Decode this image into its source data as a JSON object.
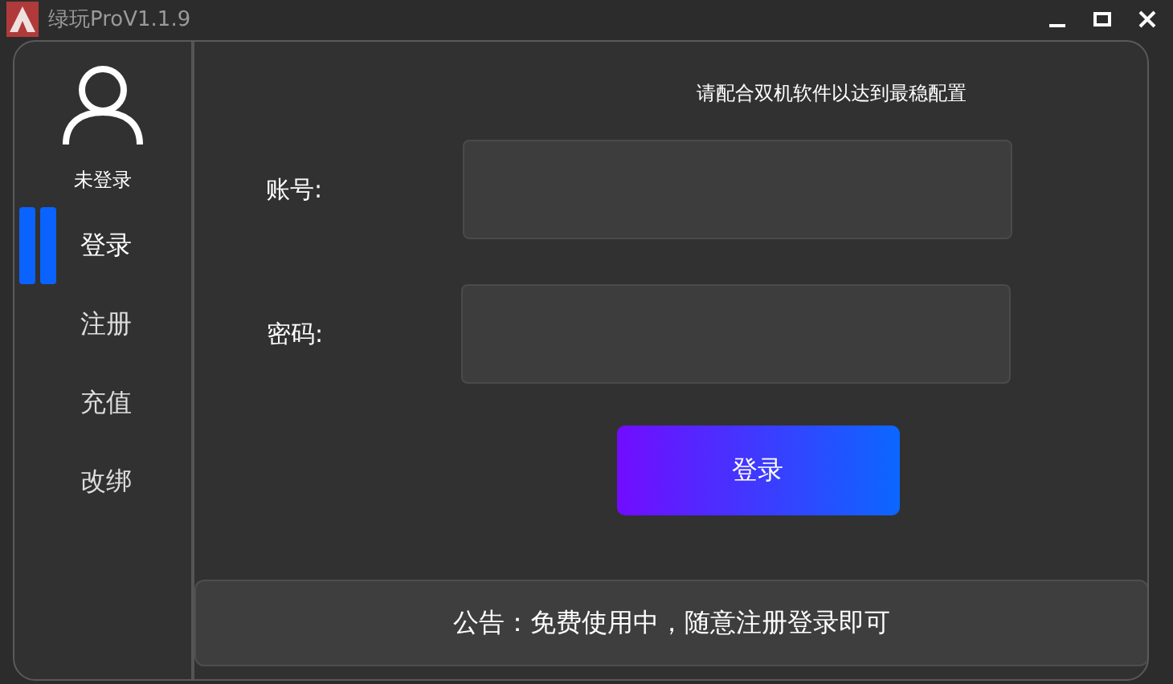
{
  "window": {
    "title": "绿玩ProV1.1.9"
  },
  "sidebar": {
    "user_status": "未登录",
    "items": [
      {
        "label": "登录",
        "selected": true
      },
      {
        "label": "注册",
        "selected": false
      },
      {
        "label": "充值",
        "selected": false
      },
      {
        "label": "改绑",
        "selected": false
      }
    ]
  },
  "form": {
    "hint": "请配合双机软件以达到最稳配置",
    "fields": [
      {
        "label": "账号:"
      },
      {
        "label": "密码:"
      }
    ],
    "submit": "登录"
  },
  "notice": "公告：免费使用中，随意注册登录即可"
}
